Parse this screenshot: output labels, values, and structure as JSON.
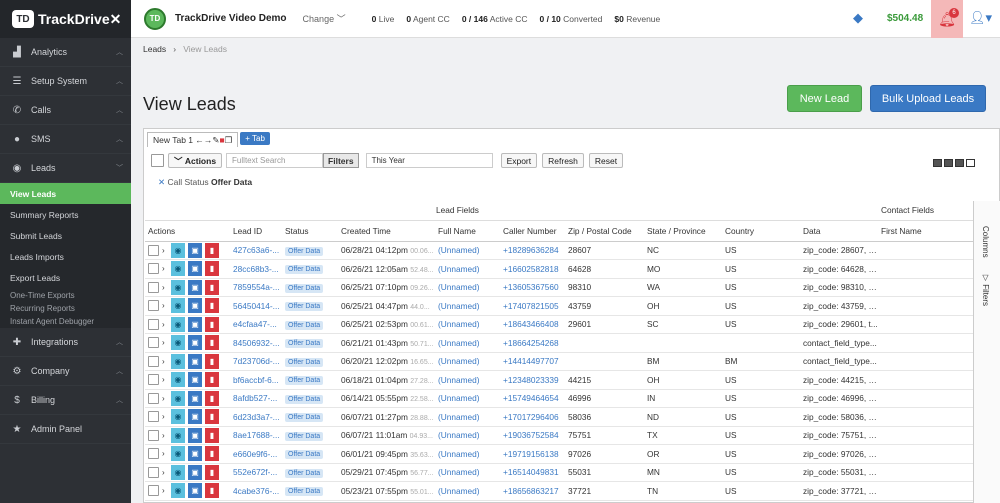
{
  "sidebar": {
    "brand": "TrackDrive",
    "brand_mark": "TD",
    "items": [
      {
        "label": "Analytics",
        "icon": "chart-icon"
      },
      {
        "label": "Setup System",
        "icon": "sliders-icon"
      },
      {
        "label": "Calls",
        "icon": "phone-icon"
      },
      {
        "label": "SMS",
        "icon": "chat-icon"
      },
      {
        "label": "Leads",
        "icon": "user-icon"
      }
    ],
    "leads_sub": [
      "View Leads",
      "Summary Reports",
      "Submit Leads",
      "Leads Imports",
      "Export Leads"
    ],
    "export_sub": [
      "One-Time Exports",
      "Recurring Reports",
      "Instant Agent Debugger"
    ],
    "items2": [
      {
        "label": "Integrations",
        "icon": "puzzle-icon"
      },
      {
        "label": "Company",
        "icon": "gear-icon"
      },
      {
        "label": "Billing",
        "icon": "dollar-icon"
      },
      {
        "label": "Admin Panel",
        "icon": "star-icon"
      }
    ]
  },
  "topbar": {
    "logo_text": "TD",
    "account": "TrackDrive Video Demo",
    "change": "Change",
    "stats": [
      {
        "value": "0",
        "label": "Live"
      },
      {
        "value": "0",
        "label": "Agent CC"
      },
      {
        "value": "0 / 146",
        "label": "Active CC"
      },
      {
        "value": "0 / 10",
        "label": "Converted"
      },
      {
        "value": "$0",
        "label": "Revenue"
      }
    ],
    "balance": "$504.48",
    "notifications": "6"
  },
  "breadcrumb": {
    "root": "Leads",
    "current": "View Leads"
  },
  "page": {
    "title": "View Leads",
    "new_lead": "New Lead",
    "bulk_upload": "Bulk Upload Leads"
  },
  "tabs": {
    "tab1": "New Tab 1",
    "add_tab": "+ Tab"
  },
  "toolbar": {
    "actions": "Actions",
    "search_placeholder": "Fulltext Search",
    "filters": "Filters",
    "date_range": "This Year",
    "export": "Export",
    "refresh": "Refresh",
    "reset": "Reset"
  },
  "filter_chip": {
    "label": "Call Status",
    "value": "Offer Data"
  },
  "table": {
    "group_headers": {
      "lead_fields": "Lead Fields",
      "contact_fields": "Contact Fields"
    },
    "columns": [
      "Actions",
      "Lead ID",
      "Status",
      "Created Time",
      "Full Name",
      "Caller Number",
      "Zip / Postal Code",
      "State / Province",
      "Country",
      "Data",
      "First Name"
    ],
    "side_tabs": [
      "Columns",
      "Filters"
    ],
    "rows": [
      {
        "id": "427c63a6-...",
        "status": "Offer Data",
        "time": "06/28/21 04:12pm",
        "ms": "00.06...",
        "name": "(Unnamed)",
        "phone": "+18289636284",
        "zip": "28607",
        "state": "NC",
        "country": "US",
        "data": "zip_code: 28607, c..."
      },
      {
        "id": "28cc68b3-...",
        "status": "Offer Data",
        "time": "06/26/21 12:05am",
        "ms": "52.48...",
        "name": "(Unnamed)",
        "phone": "+16602582818",
        "zip": "64628",
        "state": "MO",
        "country": "US",
        "data": "zip_code: 64628, c..."
      },
      {
        "id": "7859554a-...",
        "status": "Offer Data",
        "time": "06/25/21 07:10pm",
        "ms": "09.26...",
        "name": "(Unnamed)",
        "phone": "+13605367560",
        "zip": "98310",
        "state": "WA",
        "country": "US",
        "data": "zip_code: 98310, c..."
      },
      {
        "id": "56450414-...",
        "status": "Offer Data",
        "time": "06/25/21 04:47pm",
        "ms": "44.0...",
        "name": "(Unnamed)",
        "phone": "+17407821505",
        "zip": "43759",
        "state": "OH",
        "country": "US",
        "data": "zip_code: 43759, c..."
      },
      {
        "id": "e4cfaa47-...",
        "status": "Offer Data",
        "time": "06/25/21 02:53pm",
        "ms": "00.61...",
        "name": "(Unnamed)",
        "phone": "+18643466408",
        "zip": "29601",
        "state": "SC",
        "country": "US",
        "data": "zip_code: 29601, t..."
      },
      {
        "id": "84506932-...",
        "status": "Offer Data",
        "time": "06/21/21 01:43pm",
        "ms": "50.71...",
        "name": "(Unnamed)",
        "phone": "+18664254268",
        "zip": "",
        "state": "",
        "country": "",
        "data": "contact_field_type..."
      },
      {
        "id": "7d23706d-...",
        "status": "Offer Data",
        "time": "06/20/21 12:02pm",
        "ms": "16.65...",
        "name": "(Unnamed)",
        "phone": "+14414497707",
        "zip": "",
        "state": "BM",
        "country": "BM",
        "data": "contact_field_type..."
      },
      {
        "id": "bf6accbf-6...",
        "status": "Offer Data",
        "time": "06/18/21 01:04pm",
        "ms": "27.28...",
        "name": "(Unnamed)",
        "phone": "+12348023339",
        "zip": "44215",
        "state": "OH",
        "country": "US",
        "data": "zip_code: 44215, c..."
      },
      {
        "id": "8afdb527-...",
        "status": "Offer Data",
        "time": "06/14/21 05:55pm",
        "ms": "22.58...",
        "name": "(Unnamed)",
        "phone": "+15749464654",
        "zip": "46996",
        "state": "IN",
        "country": "US",
        "data": "zip_code: 46996, c..."
      },
      {
        "id": "6d23d3a7-...",
        "status": "Offer Data",
        "time": "06/07/21 01:27pm",
        "ms": "28.88...",
        "name": "(Unnamed)",
        "phone": "+17017296406",
        "zip": "58036",
        "state": "ND",
        "country": "US",
        "data": "zip_code: 58036, c..."
      },
      {
        "id": "8ae17688-...",
        "status": "Offer Data",
        "time": "06/07/21 11:01am",
        "ms": "04.93...",
        "name": "(Unnamed)",
        "phone": "+19036752584",
        "zip": "75751",
        "state": "TX",
        "country": "US",
        "data": "zip_code: 75751, c..."
      },
      {
        "id": "e660e9f6-...",
        "status": "Offer Data",
        "time": "06/01/21 09:45pm",
        "ms": "35.63...",
        "name": "(Unnamed)",
        "phone": "+19719156138",
        "zip": "97026",
        "state": "OR",
        "country": "US",
        "data": "zip_code: 97026, c..."
      },
      {
        "id": "552e672f-...",
        "status": "Offer Data",
        "time": "05/29/21 07:45pm",
        "ms": "56.77...",
        "name": "(Unnamed)",
        "phone": "+16514049831",
        "zip": "55031",
        "state": "MN",
        "country": "US",
        "data": "zip_code: 55031, c..."
      },
      {
        "id": "4cabe376-...",
        "status": "Offer Data",
        "time": "05/23/21 07:55pm",
        "ms": "55.01...",
        "name": "(Unnamed)",
        "phone": "+18656863217",
        "zip": "37721",
        "state": "TN",
        "country": "US",
        "data": "zip_code: 37721, c..."
      }
    ]
  }
}
